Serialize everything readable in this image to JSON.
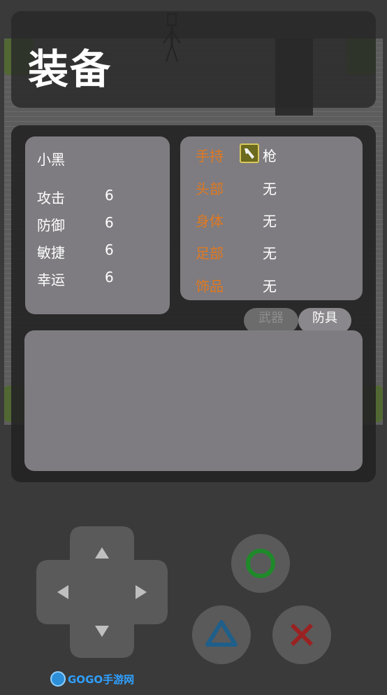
{
  "screen": {
    "title": "装备"
  },
  "stats_panel": {
    "character_name": "小黑",
    "stats": [
      {
        "label": "攻击",
        "value": "6"
      },
      {
        "label": "防御",
        "value": "6"
      },
      {
        "label": "敏捷",
        "value": "6"
      },
      {
        "label": "幸运",
        "value": "6"
      }
    ]
  },
  "equipment_panel": {
    "slots": [
      {
        "label": "手持",
        "value": "枪",
        "icon": "gun-icon"
      },
      {
        "label": "头部",
        "value": "无"
      },
      {
        "label": "身体",
        "value": "无"
      },
      {
        "label": "足部",
        "value": "无"
      },
      {
        "label": "饰品",
        "value": "无"
      }
    ]
  },
  "tabs": [
    {
      "label": "武器",
      "active": false
    },
    {
      "label": "防具",
      "active": true
    }
  ],
  "controls": {
    "dpad": [
      "up-arrow-icon",
      "down-arrow-icon",
      "left-arrow-icon",
      "right-arrow-icon"
    ],
    "buttons": [
      "circle-icon",
      "triangle-icon",
      "cross-icon"
    ]
  },
  "watermark": {
    "text": "GOGO手游网"
  },
  "colors": {
    "slot_label": "#e07820",
    "circle_button": "#1f8a2a",
    "triangle_button": "#1f5f8a",
    "cross_button": "#9a2222"
  }
}
